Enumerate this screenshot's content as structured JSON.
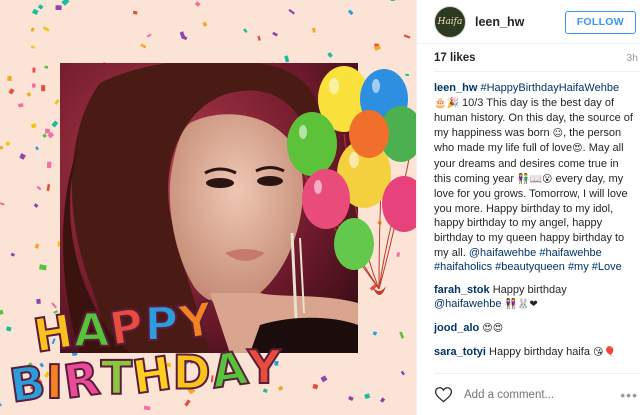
{
  "post": {
    "username": "leen_hw",
    "avatar_text": "Haifa",
    "follow_label": "FOLLOW",
    "likes": "17 likes",
    "time": "3h"
  },
  "image": {
    "banner_line1": [
      "H",
      "A",
      "P",
      "P",
      "Y"
    ],
    "banner_line2": [
      "B",
      "I",
      "R",
      "T",
      "H",
      "D",
      "A",
      "Y"
    ],
    "banner_colors": [
      "#f9c21c",
      "#55c43a",
      "#e84c3d",
      "#2d9cdb",
      "#f58220",
      "#e94b9a",
      "#8cc63f",
      "#ffcf1f"
    ]
  },
  "caption": {
    "user": "leen_hw",
    "hashtag1": "#HappyBirthdayHaifaWehbe",
    "emoji1": "🎂🎉",
    "text1": "10/3 This day is the best day of human history. On this day, the source of my happiness was born",
    "emoji2": "☺",
    "text2": ", the person who made my life full of love",
    "emoji3": "😍",
    "text3": ". May all your dreams and desires come true in this coming year",
    "emoji4": "👫📖😮",
    "text4": " every day, my love for you grows. Tomorrow, I will love you more. Happy birthday to my idol, happy birthday to my angel, happy birthday to my queen happy birthday to my all.",
    "mention": "@haifawehbe",
    "hashtags": "#haifawehbe #haifaholics #beautyqueen #my #Love"
  },
  "comments": [
    {
      "user": "farah_stok",
      "text": "Happy birthday",
      "mention": "@haifawehbe",
      "emoji": "👭🐰❤"
    },
    {
      "user": "jood_alo",
      "text": "",
      "mention": "",
      "emoji": "😍😍"
    },
    {
      "user": "sara_totyi",
      "text": "Happy birthday haifa",
      "mention": "",
      "emoji": "😘🎈"
    }
  ],
  "footer": {
    "add_comment_placeholder": "Add a comment...",
    "more_label": "•••"
  },
  "colors": {
    "link": "#003569",
    "follow": "#3897f0",
    "muted": "#999999"
  }
}
